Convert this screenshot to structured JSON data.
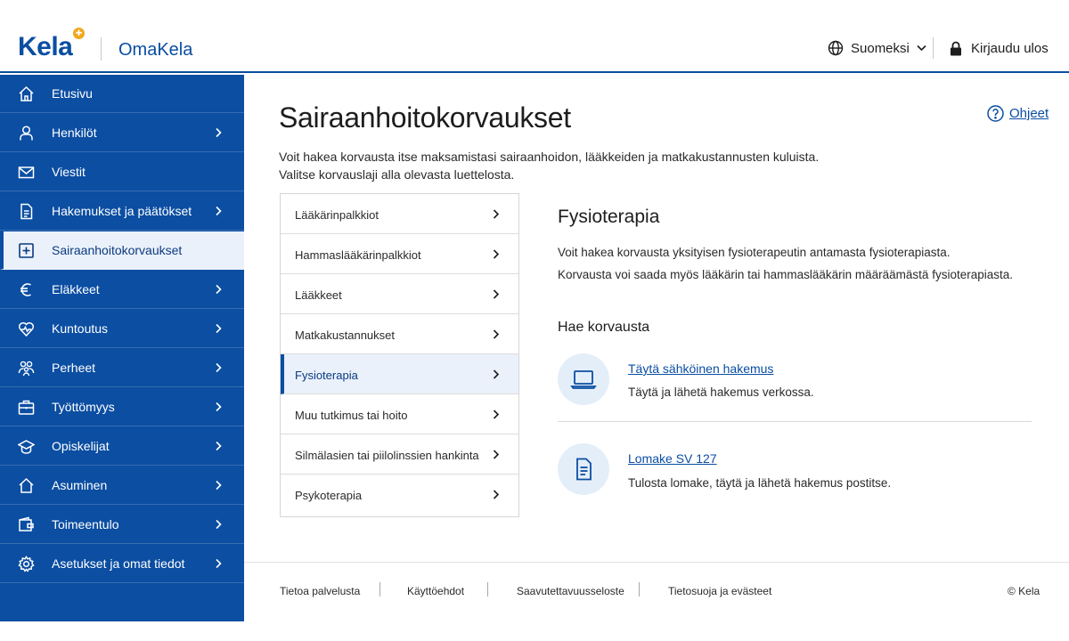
{
  "header": {
    "logo_text": "Kela",
    "service_name": "OmaKela",
    "language": "Suomeksi",
    "logout_label": "Kirjaudu ulos",
    "brand_color": "#0b4ea2",
    "accent_color": "#f0a81e"
  },
  "sidebar": {
    "items": [
      {
        "label": "Etusivu",
        "icon": "home-icon",
        "has_chevron": false,
        "active": false
      },
      {
        "label": "Henkilöt",
        "icon": "person-icon",
        "has_chevron": true,
        "active": false
      },
      {
        "label": "Viestit",
        "icon": "envelope-icon",
        "has_chevron": false,
        "active": false
      },
      {
        "label": "Hakemukset ja päätökset",
        "icon": "document-icon",
        "has_chevron": true,
        "active": false
      },
      {
        "label": "Sairaanhoitokorvaukset",
        "icon": "plus-square-icon",
        "has_chevron": false,
        "active": true
      },
      {
        "label": "Eläkkeet",
        "icon": "euro-icon",
        "has_chevron": true,
        "active": false
      },
      {
        "label": "Kuntoutus",
        "icon": "heart-pulse-icon",
        "has_chevron": true,
        "active": false
      },
      {
        "label": "Perheet",
        "icon": "family-icon",
        "has_chevron": true,
        "active": false
      },
      {
        "label": "Työttömyys",
        "icon": "briefcase-icon",
        "has_chevron": true,
        "active": false
      },
      {
        "label": "Opiskelijat",
        "icon": "graduation-cap-icon",
        "has_chevron": true,
        "active": false
      },
      {
        "label": "Asuminen",
        "icon": "house-icon",
        "has_chevron": true,
        "active": false
      },
      {
        "label": "Toimeentulo",
        "icon": "wallet-icon",
        "has_chevron": true,
        "active": false
      },
      {
        "label": "Asetukset ja omat tiedot",
        "icon": "gear-icon",
        "has_chevron": true,
        "active": false
      }
    ]
  },
  "main": {
    "help_label": "Ohjeet",
    "title": "Sairaanhoitokorvaukset",
    "intro_line1": "Voit hakea korvausta itse maksamistasi sairaanhoidon, lääkkeiden ja matkakustannusten kuluista.",
    "intro_line2": "Valitse korvauslaji alla olevasta luettelosta.",
    "types": [
      {
        "label": "Lääkärinpalkkiot",
        "selected": false
      },
      {
        "label": "Hammaslääkärinpalkkiot",
        "selected": false
      },
      {
        "label": "Lääkkeet",
        "selected": false
      },
      {
        "label": "Matkakustannukset",
        "selected": false
      },
      {
        "label": "Fysioterapia",
        "selected": true
      },
      {
        "label": "Muu tutkimus tai hoito",
        "selected": false
      },
      {
        "label": "Silmälasien tai piilolinssien hankinta",
        "selected": false
      },
      {
        "label": "Psykoterapia",
        "selected": false
      }
    ],
    "detail": {
      "title": "Fysioterapia",
      "p1": "Voit hakea korvausta yksityisen fysioterapeutin antamasta fysioterapiasta.",
      "p2": "Korvausta voi saada myös lääkärin tai hammaslääkärin määräämästä fysioterapiasta.",
      "apply_heading": "Hae korvausta",
      "options": [
        {
          "icon": "laptop-icon",
          "link": "Täytä sähköinen hakemus",
          "desc": "Täytä ja lähetä hakemus verkossa."
        },
        {
          "icon": "form-document-icon",
          "link": "Lomake SV 127",
          "desc": "Tulosta lomake, täytä ja lähetä hakemus postitse."
        }
      ]
    }
  },
  "footer": {
    "links": [
      "Tietoa palvelusta",
      "Käyttöehdot",
      "Saavutettavuusseloste",
      "Tietosuoja ja evästeet"
    ],
    "copyright": "© Kela"
  }
}
